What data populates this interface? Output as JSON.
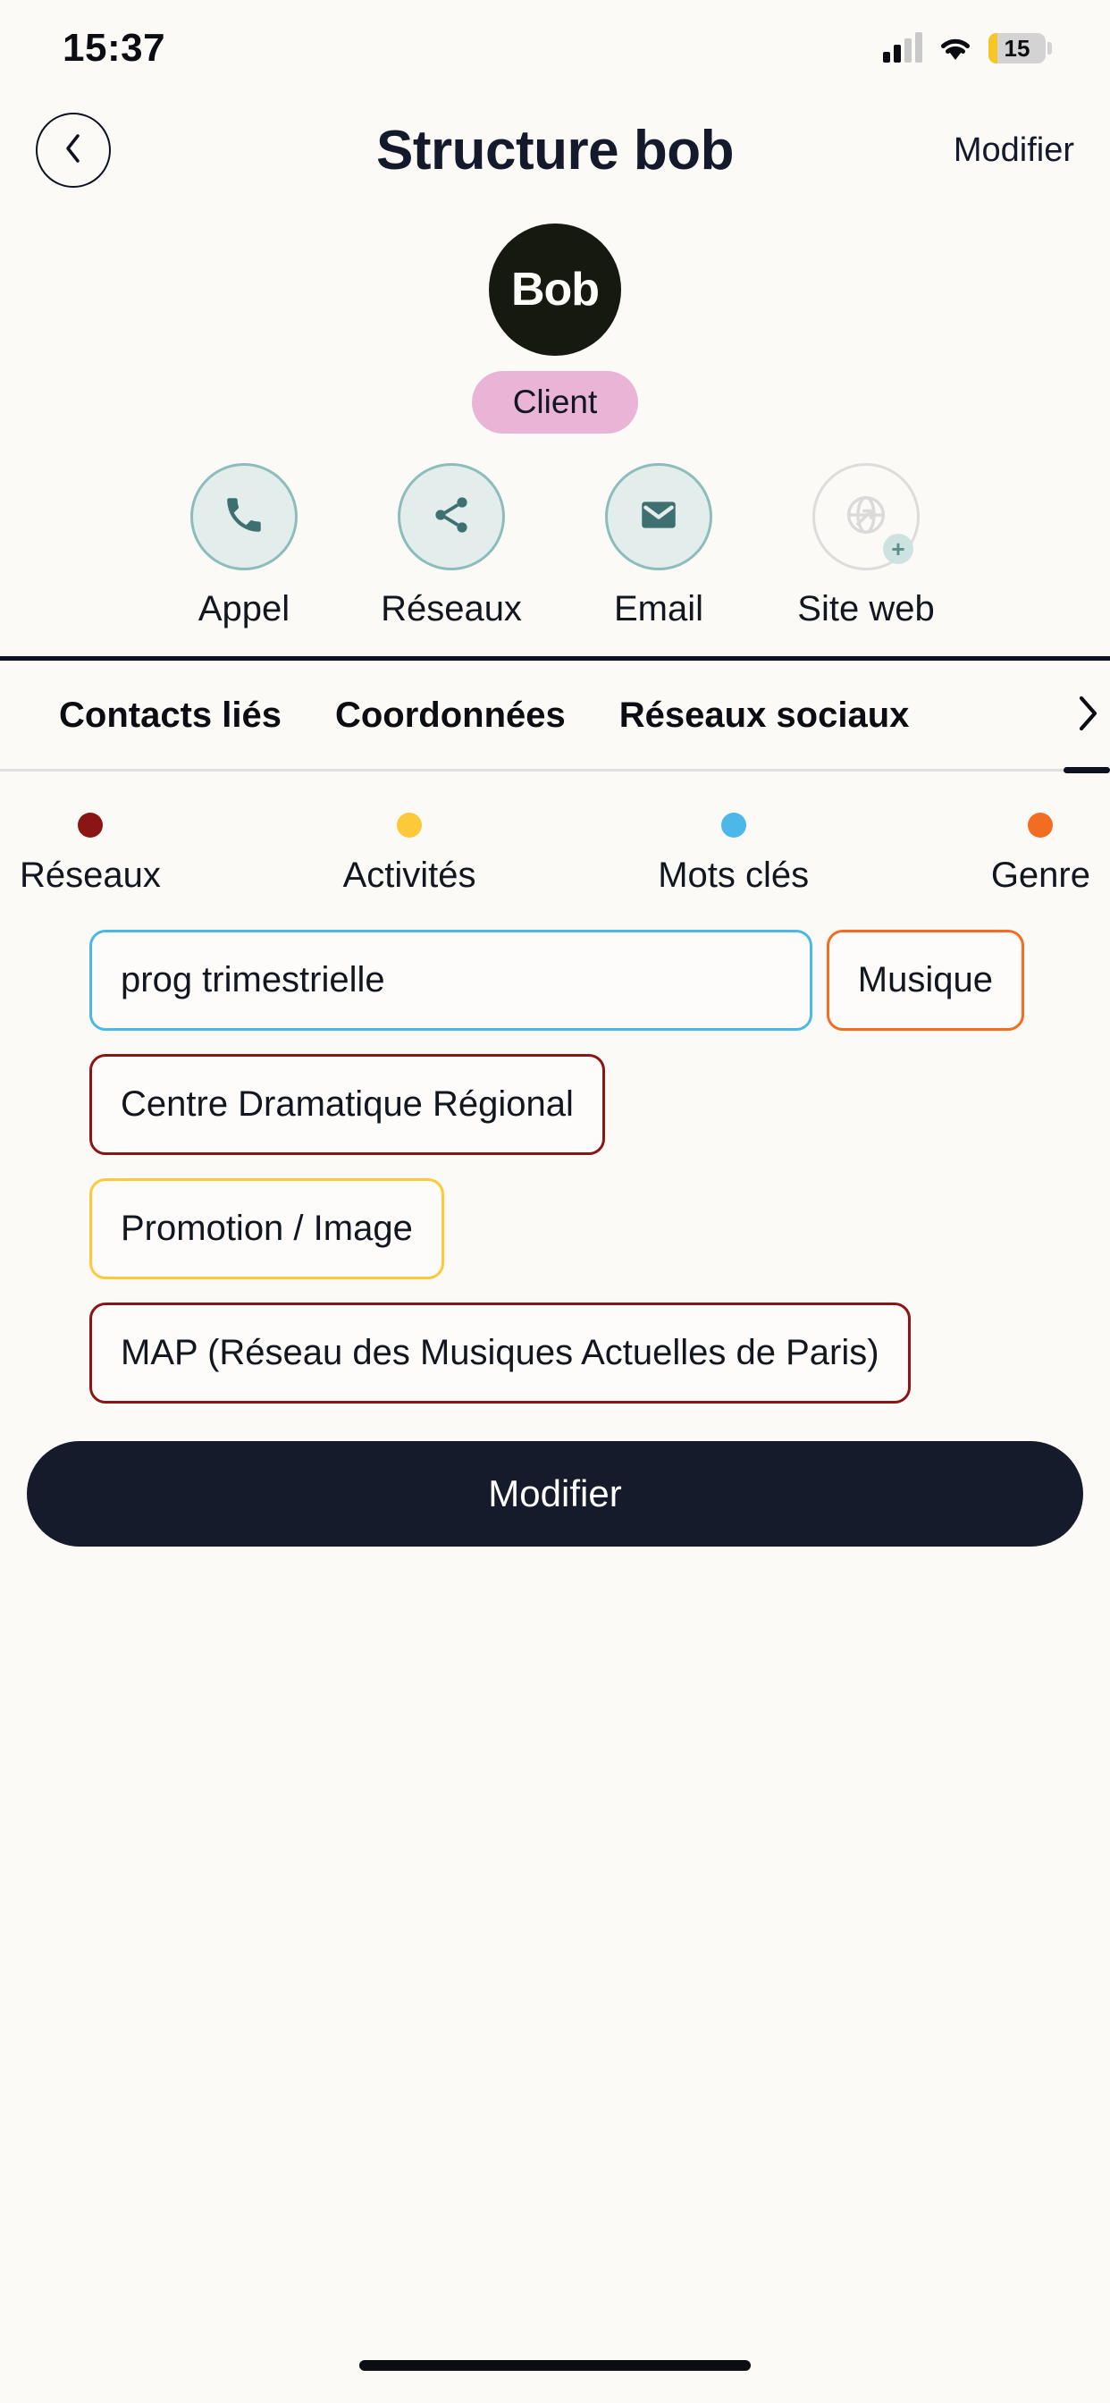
{
  "status_bar": {
    "time": "15:37",
    "battery_percent": "15",
    "signal_icon": "cellular-signal-icon",
    "wifi_icon": "wifi-icon",
    "battery_icon": "battery-icon"
  },
  "header": {
    "back_icon": "chevron-left-icon",
    "title": "Structure bob",
    "action_label": "Modifier"
  },
  "profile": {
    "avatar_initials": "Bob",
    "avatar_color": "#15190f",
    "badge_label": "Client",
    "badge_color": "#e9b4d6"
  },
  "actions": [
    {
      "label": "Appel",
      "icon": "phone-icon",
      "enabled": true
    },
    {
      "label": "Réseaux",
      "icon": "share-icon",
      "enabled": true
    },
    {
      "label": "Email",
      "icon": "mail-icon",
      "enabled": true
    },
    {
      "label": "Site web",
      "icon": "globe-icon",
      "enabled": false,
      "badge_icon": "plus-icon"
    }
  ],
  "tabs": {
    "items": [
      {
        "label": "Contacts liés"
      },
      {
        "label": "Coordonnées"
      },
      {
        "label": "Réseaux sociaux"
      }
    ],
    "next_icon": "chevron-right-icon"
  },
  "legend": [
    {
      "label": "Réseaux",
      "color": "#8b1514"
    },
    {
      "label": "Activités",
      "color": "#fcc93b"
    },
    {
      "label": "Mots clés",
      "color": "#4cb8e8"
    },
    {
      "label": "Genre",
      "color": "#f26d22"
    }
  ],
  "chips": [
    [
      {
        "label": "prog trimestrielle",
        "color": "#4cb8e8",
        "grow": true
      },
      {
        "label": "Musique",
        "color": "#f26d22",
        "grow": false
      }
    ],
    [
      {
        "label": "Centre Dramatique Régional",
        "color": "#8b1514",
        "grow": false
      }
    ],
    [
      {
        "label": "Promotion / Image",
        "color": "#fcc93b",
        "grow": false
      }
    ],
    [
      {
        "label": "MAP (Réseau des Musiques Actuelles de Paris)",
        "color": "#8b1514",
        "grow": false
      }
    ]
  ],
  "primary_button": {
    "label": "Modifier",
    "color": "#151b2b"
  }
}
